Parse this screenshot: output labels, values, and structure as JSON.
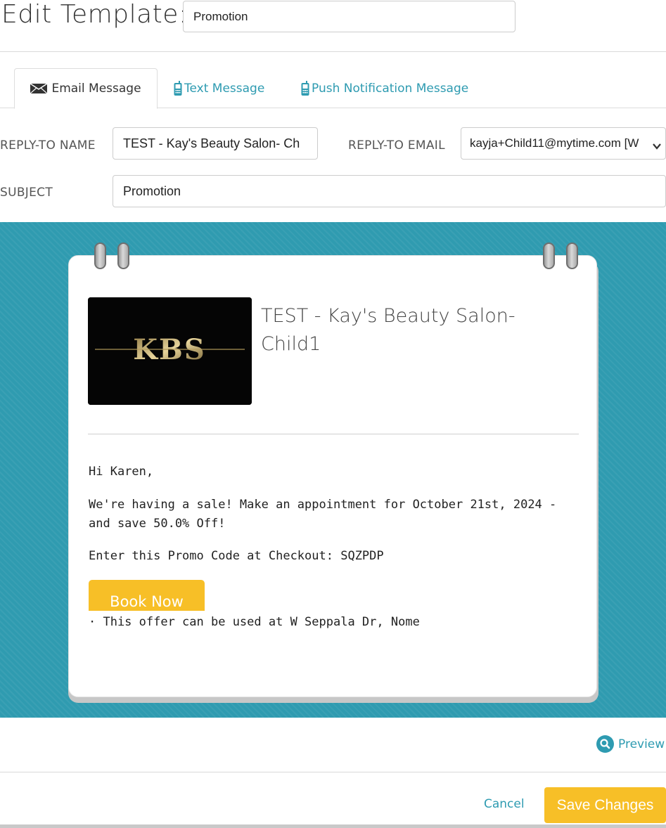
{
  "header": {
    "title": "Edit Template:",
    "template_name": "Promotion"
  },
  "tabs": [
    {
      "label": "Email Message",
      "icon": "envelope-icon",
      "active": true
    },
    {
      "label": "Text Message",
      "icon": "phone-icon",
      "active": false
    },
    {
      "label": "Push Notification Message",
      "icon": "phone-icon",
      "active": false
    }
  ],
  "form": {
    "reply_to_name_label": "REPLY-TO NAME",
    "reply_to_name_value": "TEST - Kay's Beauty Salon- Ch",
    "reply_to_email_label": "REPLY-TO EMAIL",
    "reply_to_email_value": "kayja+Child11@mytime.com [W",
    "subject_label": "SUBJECT",
    "subject_value": "Promotion"
  },
  "email_preview": {
    "business_name": "TEST - Kay's Beauty Salon- Child1",
    "logo_text": "KBS",
    "greeting": "Hi Karen,",
    "sale_text": "We're having a sale! Make an appointment for October 21st, 2024 - and save 50.0% Off!",
    "promo_text": "Enter this Promo Code at Checkout: SQZPDP",
    "book_button": "Book Now",
    "location_note": "· This offer can be used at W Seppala Dr, Nome"
  },
  "actions": {
    "preview": "Preview",
    "cancel": "Cancel",
    "save": "Save Changes"
  },
  "colors": {
    "accent": "#2e9bb1",
    "button": "#f7bf27",
    "preview_bg": "#2f9bb0"
  }
}
